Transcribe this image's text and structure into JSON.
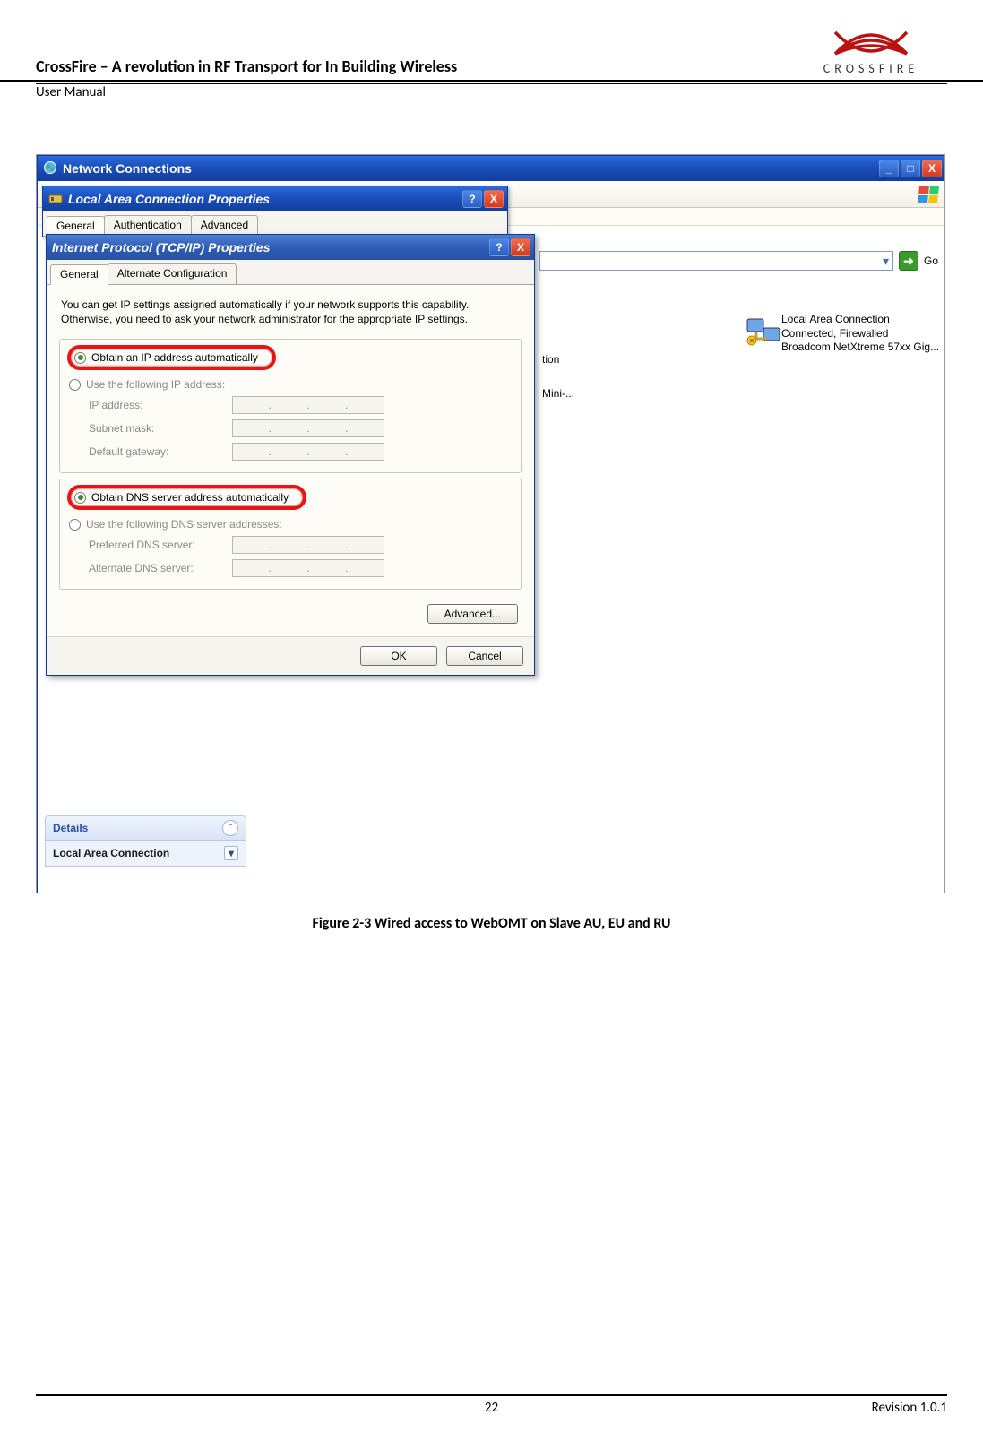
{
  "doc": {
    "title": "CrossFire – A revolution in RF Transport for In Building Wireless",
    "manual": "User Manual",
    "logo_text": "CROSSFIRE"
  },
  "figure": {
    "caption": "Figure 2-3 Wired access to WebOMT on Slave AU, EU and RU"
  },
  "outer_window": {
    "title": "Network Connections",
    "min": "_",
    "max": "□",
    "close": "X",
    "go_label": "Go"
  },
  "lacp_window": {
    "title": "Local Area Connection Properties",
    "help": "?",
    "close": "X",
    "tabs": {
      "general": "General",
      "auth": "Authentication",
      "advanced": "Advanced"
    }
  },
  "tcpip_window": {
    "title": "Internet Protocol (TCP/IP) Properties",
    "help": "?",
    "close": "X",
    "tabs": {
      "general": "General",
      "alternate": "Alternate Configuration"
    },
    "desc": "You can get IP settings assigned automatically if your network supports this capability. Otherwise, you need to ask your network administrator for the appropriate IP settings.",
    "radio_obtain_ip": "Obtain an IP address automatically",
    "radio_use_ip": "Use the following IP address:",
    "ip_address": "IP address:",
    "subnet": "Subnet mask:",
    "gateway": "Default gateway:",
    "radio_obtain_dns": "Obtain DNS server address automatically",
    "radio_use_dns": "Use the following DNS server addresses:",
    "pref_dns": "Preferred DNS server:",
    "alt_dns": "Alternate DNS server:",
    "advanced_btn": "Advanced...",
    "ok": "OK",
    "cancel": "Cancel"
  },
  "adapter": {
    "line1": "Local Area Connection",
    "line2": "Connected, Firewalled",
    "line3": "Broadcom NetXtreme 57xx Gig..."
  },
  "peek": {
    "p1": "tion",
    "p2": "Mini-..."
  },
  "details_panel": {
    "details": "Details",
    "lac": "Local Area Connection"
  },
  "footer": {
    "page": "22",
    "revision": "Revision 1.0.1"
  }
}
